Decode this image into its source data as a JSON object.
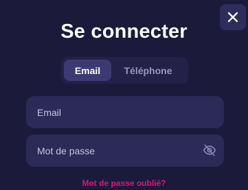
{
  "modal": {
    "title": "Se connecter",
    "close_icon": "close-icon"
  },
  "tabs": [
    {
      "label": "Email",
      "active": true
    },
    {
      "label": "Téléphone",
      "active": false
    }
  ],
  "form": {
    "email": {
      "placeholder": "Email",
      "value": ""
    },
    "password": {
      "placeholder": "Mot de passe",
      "value": "",
      "toggle_icon": "eye-off-icon"
    }
  },
  "links": {
    "forgot_password": "Mot de passe oublié?"
  },
  "colors": {
    "background": "#1b1a3b",
    "field": "#2c2a56",
    "tab_active": "#3c3a72",
    "link": "#d6177a"
  }
}
